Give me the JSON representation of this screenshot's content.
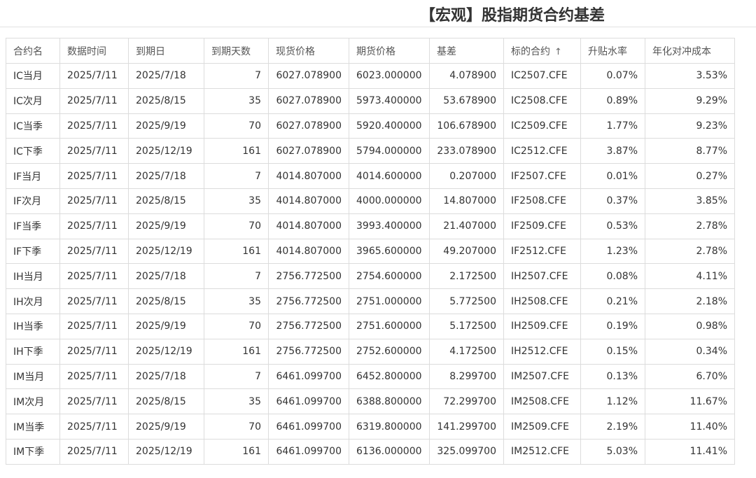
{
  "title": "【宏观】股指期货合约基差",
  "columns": [
    "合约名",
    "数据时间",
    "到期日",
    "到期天数",
    "现货价格",
    "期货价格",
    "基差",
    "标的合约",
    "升贴水率",
    "年化对冲成本"
  ],
  "sort_icon": "arrow-up-icon",
  "sort_glyph": "↑",
  "rows": [
    [
      "IC当月",
      "2025/7/11",
      "2025/7/18",
      "7",
      "6027.078900",
      "6023.000000",
      "4.078900",
      "IC2507.CFE",
      "0.07%",
      "3.53%"
    ],
    [
      "IC次月",
      "2025/7/11",
      "2025/8/15",
      "35",
      "6027.078900",
      "5973.400000",
      "53.678900",
      "IC2508.CFE",
      "0.89%",
      "9.29%"
    ],
    [
      "IC当季",
      "2025/7/11",
      "2025/9/19",
      "70",
      "6027.078900",
      "5920.400000",
      "106.678900",
      "IC2509.CFE",
      "1.77%",
      "9.23%"
    ],
    [
      "IC下季",
      "2025/7/11",
      "2025/12/19",
      "161",
      "6027.078900",
      "5794.000000",
      "233.078900",
      "IC2512.CFE",
      "3.87%",
      "8.77%"
    ],
    [
      "IF当月",
      "2025/7/11",
      "2025/7/18",
      "7",
      "4014.807000",
      "4014.600000",
      "0.207000",
      "IF2507.CFE",
      "0.01%",
      "0.27%"
    ],
    [
      "IF次月",
      "2025/7/11",
      "2025/8/15",
      "35",
      "4014.807000",
      "4000.000000",
      "14.807000",
      "IF2508.CFE",
      "0.37%",
      "3.85%"
    ],
    [
      "IF当季",
      "2025/7/11",
      "2025/9/19",
      "70",
      "4014.807000",
      "3993.400000",
      "21.407000",
      "IF2509.CFE",
      "0.53%",
      "2.78%"
    ],
    [
      "IF下季",
      "2025/7/11",
      "2025/12/19",
      "161",
      "4014.807000",
      "3965.600000",
      "49.207000",
      "IF2512.CFE",
      "1.23%",
      "2.78%"
    ],
    [
      "IH当月",
      "2025/7/11",
      "2025/7/18",
      "7",
      "2756.772500",
      "2754.600000",
      "2.172500",
      "IH2507.CFE",
      "0.08%",
      "4.11%"
    ],
    [
      "IH次月",
      "2025/7/11",
      "2025/8/15",
      "35",
      "2756.772500",
      "2751.000000",
      "5.772500",
      "IH2508.CFE",
      "0.21%",
      "2.18%"
    ],
    [
      "IH当季",
      "2025/7/11",
      "2025/9/19",
      "70",
      "2756.772500",
      "2751.600000",
      "5.172500",
      "IH2509.CFE",
      "0.19%",
      "0.98%"
    ],
    [
      "IH下季",
      "2025/7/11",
      "2025/12/19",
      "161",
      "2756.772500",
      "2752.600000",
      "4.172500",
      "IH2512.CFE",
      "0.15%",
      "0.34%"
    ],
    [
      "IM当月",
      "2025/7/11",
      "2025/7/18",
      "7",
      "6461.099700",
      "6452.800000",
      "8.299700",
      "IM2507.CFE",
      "0.13%",
      "6.70%"
    ],
    [
      "IM次月",
      "2025/7/11",
      "2025/8/15",
      "35",
      "6461.099700",
      "6388.800000",
      "72.299700",
      "IM2508.CFE",
      "1.12%",
      "11.67%"
    ],
    [
      "IM当季",
      "2025/7/11",
      "2025/9/19",
      "70",
      "6461.099700",
      "6319.800000",
      "141.299700",
      "IM2509.CFE",
      "2.19%",
      "11.40%"
    ],
    [
      "IM下季",
      "2025/7/11",
      "2025/12/19",
      "161",
      "6461.099700",
      "6136.000000",
      "325.099700",
      "IM2512.CFE",
      "5.03%",
      "11.41%"
    ]
  ]
}
